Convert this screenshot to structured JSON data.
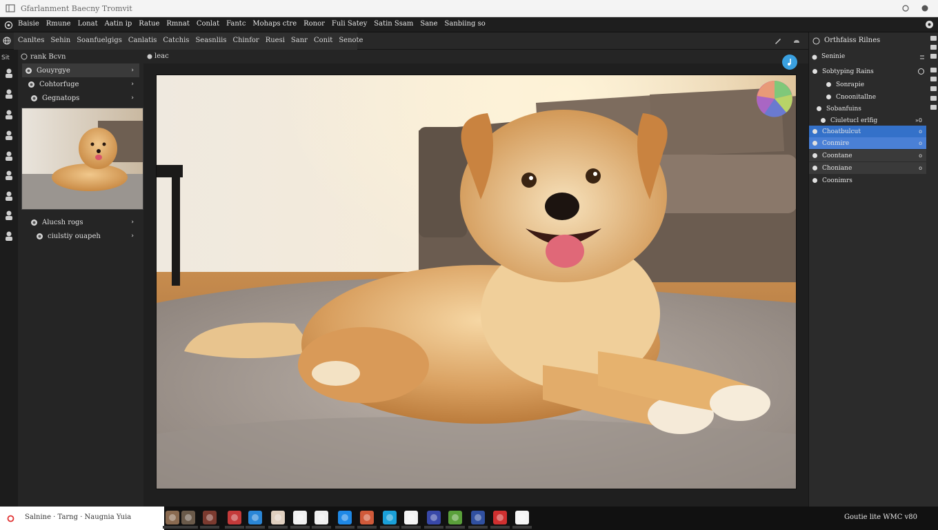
{
  "window": {
    "title": "Gfarlanment Baecny Tromvit"
  },
  "menubar": {
    "items": [
      "Baisie",
      "Rmune",
      "Lonat",
      "Aatin ip",
      "Ratue",
      "Rmnat",
      "Conlat",
      "Fantc",
      "Mohaps ctre",
      "Ronor",
      "Fuli Satey",
      "Satin Ssam",
      "Sane",
      "Sanbiing so"
    ]
  },
  "toolbar": {
    "items": [
      "Canltes",
      "Sehin",
      "Soanfuelgigs",
      "Canlatis",
      "Catchis",
      "Seasnliis",
      "Chinfor",
      "Ruesi",
      "Sanr",
      "Conit",
      "Senote"
    ]
  },
  "left_panel": {
    "header": "rank Bcvn",
    "rows": [
      {
        "label": "Gouyrgye",
        "selected": true
      },
      {
        "label": "Cohtorfuge",
        "selected": false
      },
      {
        "label": "Gegnatops",
        "selected": false
      },
      {
        "label": "Alucsh rogs",
        "selected": false
      },
      {
        "label": "ciulstiy ouapeh",
        "selected": false
      }
    ]
  },
  "canvas": {
    "header": "leac"
  },
  "right_panel": {
    "header": "Orthfaiss Rilnes",
    "sub_header": "Seninie",
    "rows": [
      {
        "label": "Sobtyping Rains",
        "tail": "",
        "style": "none"
      },
      {
        "label": "Sonrapie",
        "tail": "",
        "style": "none"
      },
      {
        "label": "Cnoonitallne",
        "tail": "",
        "style": "none"
      },
      {
        "label": "Sobanfuins",
        "tail": "",
        "style": "none"
      },
      {
        "label": "Ciuletucl erlfig",
        "tail": "»0",
        "style": "none"
      },
      {
        "label": "Choatbulcut",
        "tail": "o",
        "style": "sel"
      },
      {
        "label": "Conmire",
        "tail": "o",
        "style": "sel2"
      },
      {
        "label": "Coontane",
        "tail": "o",
        "style": "gray"
      },
      {
        "label": "Choniane",
        "tail": "o",
        "style": "gray"
      },
      {
        "label": "Coonimrs",
        "tail": "",
        "style": "none"
      }
    ]
  },
  "taskbar": {
    "search_label": "Salnine · Tarng · Naugnia Yuia",
    "tray": "Goutie lite  WMC v80",
    "apps": [
      {
        "name": "app-1",
        "color": "#8a6a50"
      },
      {
        "name": "app-2",
        "color": "#6a5a4a"
      },
      {
        "name": "app-3",
        "color": "#7b3a2f"
      },
      {
        "name": "app-4",
        "color": "#c43a3a"
      },
      {
        "name": "app-5",
        "color": "#2a86d6"
      },
      {
        "name": "app-6",
        "color": "#e0d0c0"
      },
      {
        "name": "app-7",
        "color": "#f0f0f0"
      },
      {
        "name": "app-8",
        "color": "#f0f0f0"
      },
      {
        "name": "app-9",
        "color": "#1e88e5"
      },
      {
        "name": "app-10",
        "color": "#d05a3a"
      },
      {
        "name": "app-11",
        "color": "#1aa0d8"
      },
      {
        "name": "app-12",
        "color": "#f4f4f4"
      },
      {
        "name": "app-13",
        "color": "#3848a8"
      },
      {
        "name": "app-14",
        "color": "#5aa03a"
      },
      {
        "name": "app-15",
        "color": "#3050a0"
      },
      {
        "name": "app-16",
        "color": "#d03030"
      },
      {
        "name": "app-17",
        "color": "#f6f6f6"
      }
    ]
  },
  "colors": {
    "selection": "#3471c9",
    "fab": "#3aa0e0",
    "panel": "#2b2b2b"
  }
}
